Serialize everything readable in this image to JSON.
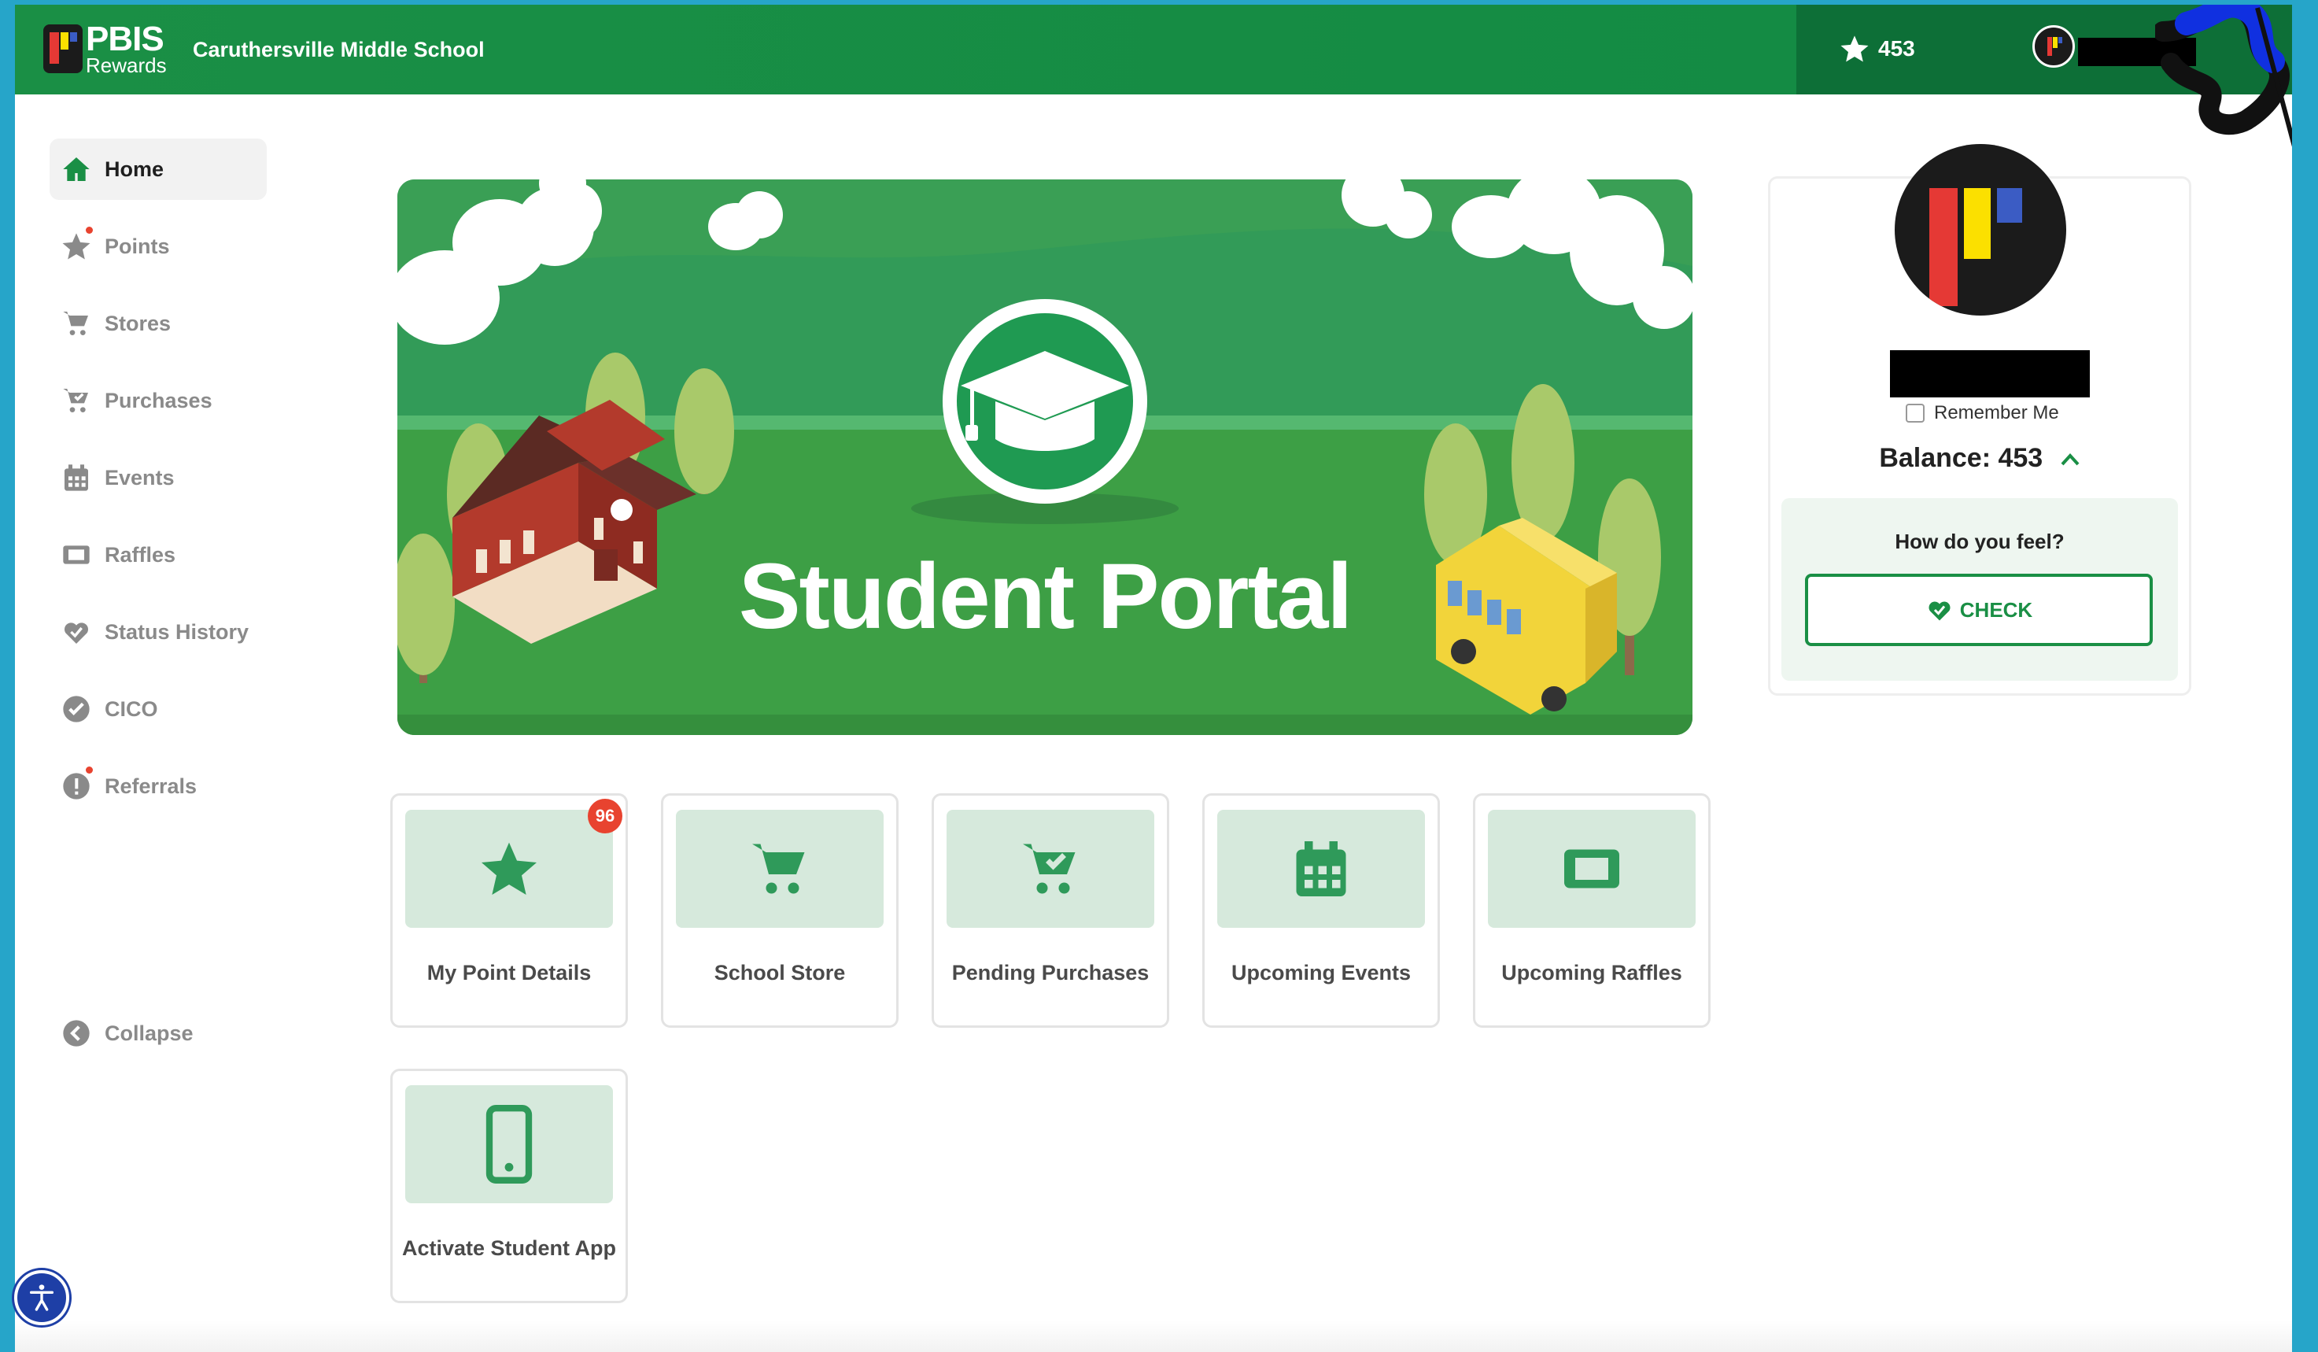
{
  "header": {
    "logo_main": "PBIS",
    "logo_sub": "Rewards",
    "school_name": "Caruthersville Middle School",
    "points": "453"
  },
  "sidebar": {
    "items": [
      {
        "label": "Home",
        "icon": "home-icon",
        "active": true
      },
      {
        "label": "Points",
        "icon": "star-icon",
        "notification": true
      },
      {
        "label": "Stores",
        "icon": "cart-icon"
      },
      {
        "label": "Purchases",
        "icon": "cart-check-icon"
      },
      {
        "label": "Events",
        "icon": "calendar-icon"
      },
      {
        "label": "Raffles",
        "icon": "ticket-icon"
      },
      {
        "label": "Status History",
        "icon": "heart-icon"
      },
      {
        "label": "CICO",
        "icon": "check-circle-icon"
      },
      {
        "label": "Referrals",
        "icon": "alert-circle-icon",
        "notification": true
      }
    ],
    "collapse_label": "Collapse"
  },
  "banner": {
    "title": "Student Portal"
  },
  "tiles": [
    {
      "label": "My Point Details",
      "icon": "star-icon",
      "badge": "96"
    },
    {
      "label": "School Store",
      "icon": "cart-icon"
    },
    {
      "label": "Pending Purchases",
      "icon": "cart-check-icon"
    },
    {
      "label": "Upcoming Events",
      "icon": "calendar-icon"
    },
    {
      "label": "Upcoming Raffles",
      "icon": "ticket-icon"
    },
    {
      "label": "Activate Student App",
      "icon": "phone-icon"
    }
  ],
  "profile": {
    "remember_label": "Remember Me",
    "balance_text": "Balance: 453",
    "feel_question": "How do you feel?",
    "check_label": "CHECK"
  },
  "colors": {
    "brand_green": "#1a8f45",
    "tile_icon_bg": "#d6e9dc",
    "badge_red": "#e8432f",
    "frame_blue": "#26a5c9"
  }
}
